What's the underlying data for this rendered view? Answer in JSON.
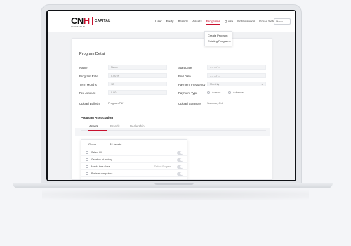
{
  "brand": {
    "mark_left": "CN",
    "mark_right": "H",
    "sub": "INDUSTRIAL",
    "capital": "CAPITAL"
  },
  "nav": {
    "items": [
      "User",
      "Party",
      "Brands",
      "Assets",
      "Programs",
      "Quote",
      "Notifications",
      "Email Setup"
    ],
    "active": "Programs",
    "user_select": "Menu"
  },
  "programs_menu": {
    "items": [
      "Create Program",
      "Existing Programs"
    ]
  },
  "program_detail": {
    "title": "Program Detail",
    "left": [
      {
        "label": "Name",
        "value": "Name"
      },
      {
        "label": "Program Rate",
        "value": "0.00 %"
      },
      {
        "label": "Term Months",
        "value": "12"
      },
      {
        "label": "Fee Amount",
        "value": "0.00"
      }
    ],
    "start_date": {
      "label": "Start Date",
      "value": "-- / -- / --"
    },
    "end_date": {
      "label": "End Date",
      "value": "-- / -- / --"
    },
    "payment_frequency": {
      "label": "Payment Frequency",
      "value": "Monthly"
    },
    "payment_type": {
      "label": "Payment Type",
      "options": [
        "Arrears",
        "Advance"
      ]
    },
    "upload_bulletin": {
      "label": "Upload Bulletin",
      "value": "Program.Pdf"
    },
    "upload_summary": {
      "label": "Upload Summary",
      "value": "Summary.Pdf"
    }
  },
  "program_association": {
    "title": "Program Association",
    "tabs": [
      "Assets",
      "Brands",
      "Dealership"
    ],
    "active_tab": "Assets",
    "panel": {
      "group_label": "Group",
      "group_value": "All Assets",
      "rows": [
        {
          "name": "Select All",
          "tag": ""
        },
        {
          "name": "Gearbox at factory",
          "tag": ""
        },
        {
          "name": "Marda tore class",
          "tag": "Default Program"
        },
        {
          "name": "Porta at computers",
          "tag": ""
        }
      ]
    }
  }
}
